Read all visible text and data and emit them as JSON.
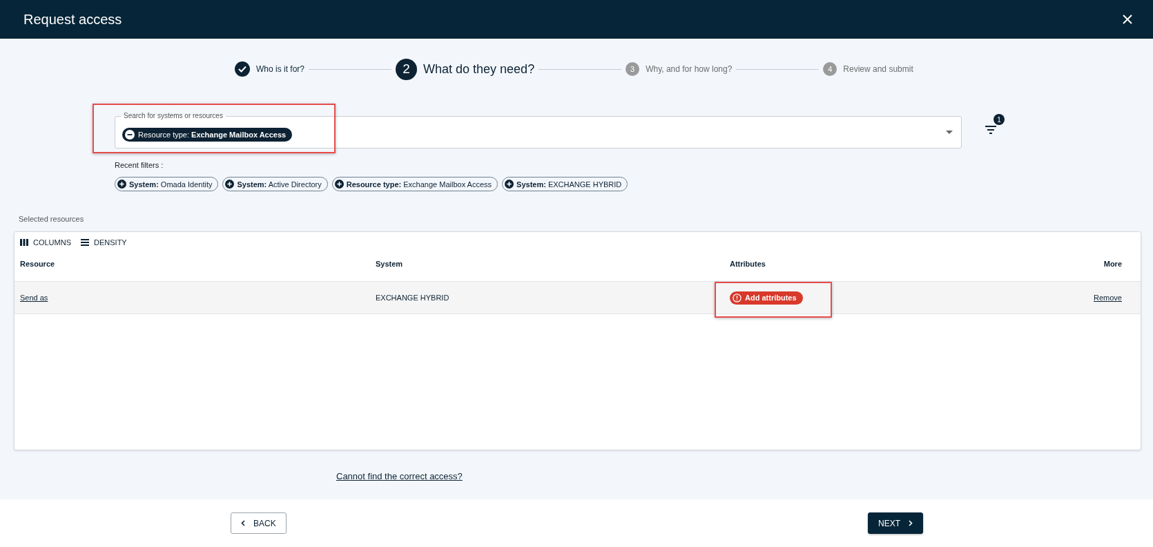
{
  "window": {
    "title": "Request access"
  },
  "steps": [
    {
      "label": "Who is it for?",
      "kind": "done"
    },
    {
      "number": "2",
      "label": "What do they need?",
      "kind": "current"
    },
    {
      "number": "3",
      "label": "Why, and for how long?",
      "kind": "upcoming"
    },
    {
      "number": "4",
      "label": "Review and submit",
      "kind": "upcoming"
    }
  ],
  "search": {
    "label": "Search for systems or resources",
    "highlighted": true,
    "chips": [
      {
        "text": "Resource type: **Exchange Mailbox Access**"
      }
    ],
    "filter_count": "1"
  },
  "recent_filters": {
    "label": "Recent filters :",
    "chips": [
      {
        "text": "**System:** Omada Identity"
      },
      {
        "text": "**System:** Active Directory"
      },
      {
        "text": "**Resource type:** Exchange Mailbox Access"
      },
      {
        "text": "**System:** EXCHANGE HYBRID"
      }
    ]
  },
  "selected_resources": {
    "label": "Selected resources",
    "toolbar": [
      {
        "kind": "columns",
        "label": "COLUMNS"
      },
      {
        "kind": "density",
        "label": "DENSITY"
      }
    ],
    "columns": [
      "Resource",
      "System",
      "Attributes",
      "More"
    ],
    "rows": [
      {
        "resource": "Send as",
        "system": "EXCHANGE HYBRID",
        "attributes": {
          "label": "Add attributes",
          "highlighted": true
        },
        "more": "Remove"
      }
    ]
  },
  "help_link": "Cannot find the correct access?",
  "buttons": {
    "back": "BACK",
    "next": "NEXT"
  }
}
